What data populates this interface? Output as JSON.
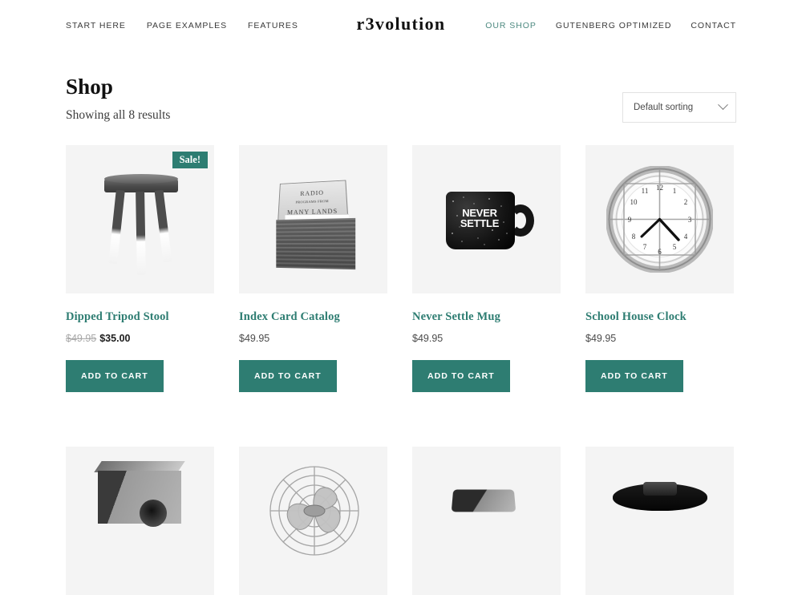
{
  "header": {
    "logo": "r3volution",
    "nav_left": [
      {
        "label": "START HERE",
        "active": false
      },
      {
        "label": "PAGE EXAMPLES",
        "active": false
      },
      {
        "label": "FEATURES",
        "active": false
      }
    ],
    "nav_right": [
      {
        "label": "OUR SHOP",
        "active": true
      },
      {
        "label": "GUTENBERG OPTIMIZED",
        "active": false
      },
      {
        "label": "CONTACT",
        "active": false
      }
    ]
  },
  "shop": {
    "title": "Shop",
    "result_count": "Showing all 8 results",
    "sorting": {
      "selected": "Default sorting",
      "icon": "chevron-down-icon"
    },
    "add_to_cart_label": "ADD TO CART",
    "sale_badge": "Sale!",
    "products": [
      {
        "name": "Dipped Tripod Stool",
        "price": "$35.00",
        "regular_price": "$49.95",
        "on_sale": true,
        "image_alt": "dipped-tripod-stool"
      },
      {
        "name": "Index Card Catalog",
        "price": "$49.95",
        "regular_price": null,
        "on_sale": false,
        "image_alt": "index-card-catalog",
        "image_text_line1": "RADIO",
        "image_text_line2": "PROGRAMS FROM",
        "image_text_line3": "MANY LANDS"
      },
      {
        "name": "Never Settle Mug",
        "price": "$49.95",
        "regular_price": null,
        "on_sale": false,
        "image_alt": "never-settle-mug",
        "image_text_line1": "NEVER",
        "image_text_line2": "SETTLE"
      },
      {
        "name": "School House Clock",
        "price": "$49.95",
        "regular_price": null,
        "on_sale": false,
        "image_alt": "school-house-clock"
      }
    ],
    "products_row2": [
      {
        "image_alt": "speaker-cabinet"
      },
      {
        "image_alt": "vintage-cage-fan"
      },
      {
        "image_alt": "projector"
      },
      {
        "image_alt": "watch-band"
      }
    ]
  },
  "colors": {
    "accent": "#2e7d72",
    "nav_active": "#4e8a81",
    "text": "#3a3a3a",
    "thumb_bg": "#f4f4f4"
  }
}
